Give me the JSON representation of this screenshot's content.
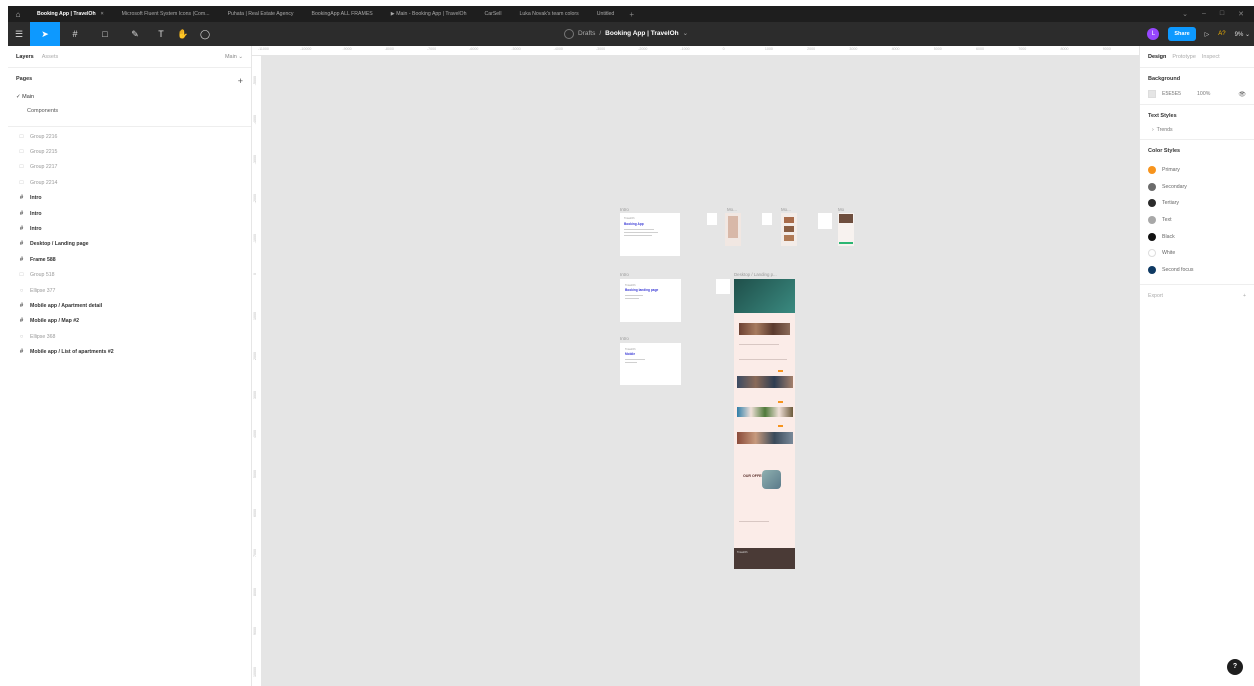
{
  "tabs": [
    {
      "label": "Booking App | TravelOh",
      "active": true
    },
    {
      "label": "Microsoft Fluent System Icons (Com..."
    },
    {
      "label": "Puhata | Real Estate Agency"
    },
    {
      "label": "BookingApp ALL FRAMES"
    },
    {
      "label": "Main - Booking App | TravelOh"
    },
    {
      "label": "CarSell"
    },
    {
      "label": "Luka Novak's team colors"
    },
    {
      "label": "Untitled"
    }
  ],
  "toolbar": {
    "breadcrumb_folder": "Drafts",
    "separator": "/",
    "file_name": "Booking App | TravelOh",
    "user_initial": "L",
    "share_label": "Share",
    "multiplayer": "A?",
    "zoom": "9%"
  },
  "left_panel": {
    "tab_layers": "Layers",
    "tab_assets": "Assets",
    "current_page": "Main",
    "pages_heading": "Pages",
    "pages": [
      {
        "label": "Main",
        "current": true
      },
      {
        "label": "Components",
        "current": false
      }
    ],
    "layers": [
      {
        "label": "Group 2216",
        "kind": "group"
      },
      {
        "label": "Group 2215",
        "kind": "group"
      },
      {
        "label": "Group 2217",
        "kind": "group"
      },
      {
        "label": "Group 2214",
        "kind": "group"
      },
      {
        "label": "Intro",
        "kind": "frame"
      },
      {
        "label": "Intro",
        "kind": "frame"
      },
      {
        "label": "Intro",
        "kind": "frame"
      },
      {
        "label": "Desktop / Landing page",
        "kind": "frame"
      },
      {
        "label": "Frame 588",
        "kind": "frame"
      },
      {
        "label": "Group 518",
        "kind": "group"
      },
      {
        "label": "Ellipse 377",
        "kind": "ellipse"
      },
      {
        "label": "Mobile app / Apartment detail",
        "kind": "frame"
      },
      {
        "label": "Mobile app / Map #2",
        "kind": "frame"
      },
      {
        "label": "Ellipse 368",
        "kind": "ellipse"
      },
      {
        "label": "Mobile app / List of apartments #2",
        "kind": "frame"
      }
    ]
  },
  "rulers": {
    "top": [
      "-11000",
      "-10000",
      "-9000",
      "-8000",
      "-7000",
      "-6000",
      "-5000",
      "-4000",
      "-3000",
      "-2000",
      "-1000",
      "0",
      "1000",
      "2000",
      "3000",
      "4000",
      "5000",
      "6000",
      "7000",
      "8000",
      "9000"
    ],
    "left": [
      "-5000",
      "-4000",
      "-3000",
      "-2000",
      "-1000",
      "0",
      "1000",
      "2000",
      "3000",
      "4000",
      "5000",
      "6000",
      "7000",
      "8000",
      "9000",
      "10000"
    ]
  },
  "canvas": {
    "frame_labels": {
      "intro_1": "Intro",
      "intro_2": "Intro",
      "intro_3": "Intro",
      "mob_1": "Mo...",
      "mob_2": "Mo...",
      "mob_3": "Mo",
      "desktop": "Desktop / Landing p..."
    },
    "intro_texts": {
      "i1_small": "TravelOh",
      "i1_title": "Booking App",
      "i2_small": "TravelOh",
      "i2_title": "Booking landing page",
      "i3_small": "TravelOh",
      "i3_title": "Mobile"
    },
    "desktop_texts": {
      "promo": "OUR OFFERS",
      "footer": "TravelOh"
    }
  },
  "right_panel": {
    "tab_design": "Design",
    "tab_prototype": "Prototype",
    "tab_inspect": "Inspect",
    "background_heading": "Background",
    "background_hex": "E5E5E5",
    "background_opacity": "100%",
    "background_color": "#e5e5e5",
    "text_styles_heading": "Text Styles",
    "text_styles": [
      {
        "label": "Trends"
      }
    ],
    "color_styles_heading": "Color Styles",
    "color_styles": [
      {
        "label": "Primary",
        "color": "#f7941d"
      },
      {
        "label": "Secondary",
        "color": "#6b6b6b"
      },
      {
        "label": "Tertiary",
        "color": "#2b2b2b"
      },
      {
        "label": "Text",
        "color": "#a8a8a8"
      },
      {
        "label": "Black",
        "color": "#111111"
      },
      {
        "label": "White",
        "color": "#ffffff"
      },
      {
        "label": "Second focus",
        "color": "#0f3a63"
      }
    ],
    "export_label": "Export"
  },
  "help_label": "?"
}
